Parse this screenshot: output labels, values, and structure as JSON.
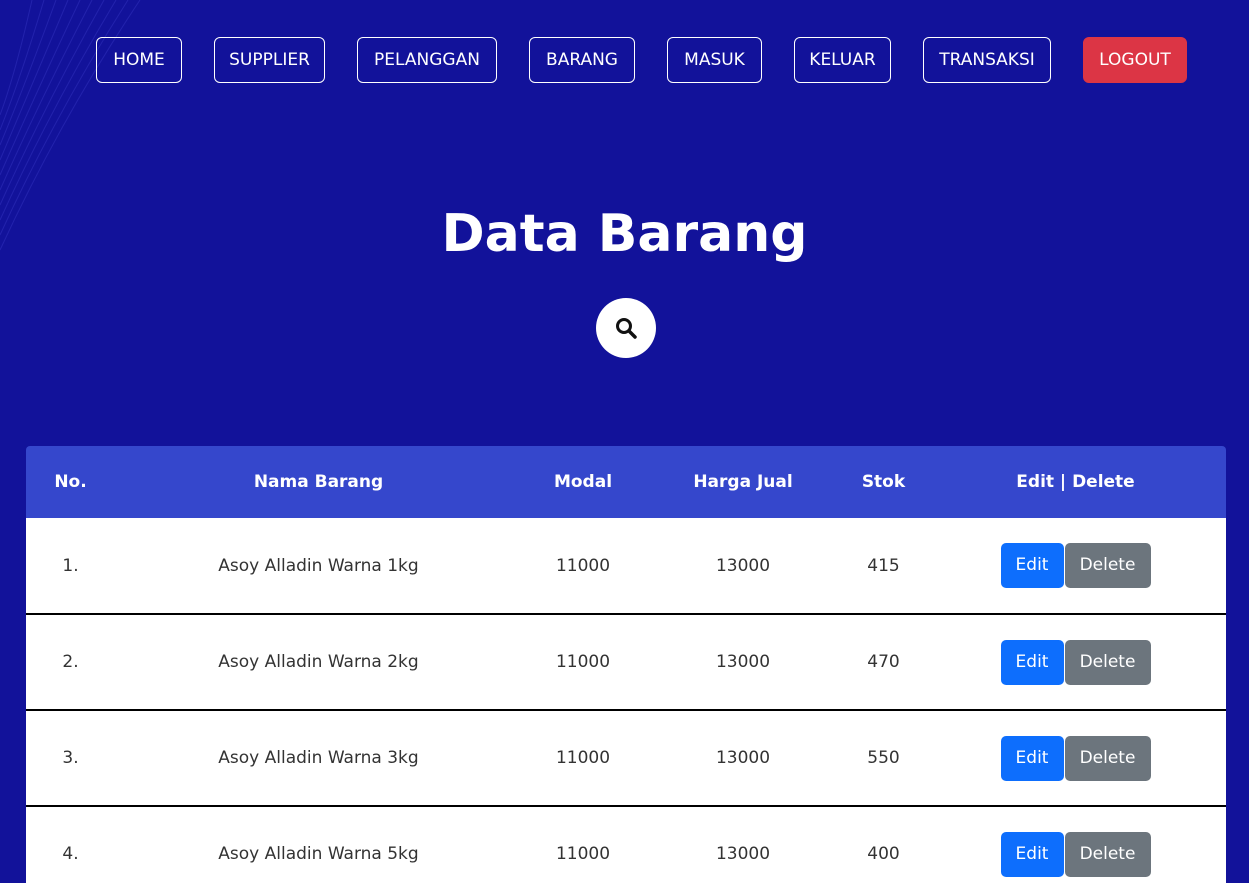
{
  "nav": {
    "items": [
      {
        "label": "HOME"
      },
      {
        "label": "SUPPLIER"
      },
      {
        "label": "PELANGGAN"
      },
      {
        "label": "BARANG"
      },
      {
        "label": "MASUK"
      },
      {
        "label": "KELUAR"
      },
      {
        "label": "TRANSAKSI"
      }
    ],
    "logout_label": "LOGOUT"
  },
  "page": {
    "title": "Data Barang",
    "search_icon": "search-icon"
  },
  "table": {
    "headers": {
      "no": "No.",
      "name": "Nama Barang",
      "modal": "Modal",
      "harga": "Harga Jual",
      "stok": "Stok",
      "actions": "Edit | Delete"
    },
    "edit_label": "Edit",
    "delete_label": "Delete",
    "rows": [
      {
        "no": "1.",
        "name": "Asoy Alladin Warna 1kg",
        "modal": "11000",
        "harga": "13000",
        "stok": "415"
      },
      {
        "no": "2.",
        "name": "Asoy Alladin Warna 2kg",
        "modal": "11000",
        "harga": "13000",
        "stok": "470"
      },
      {
        "no": "3.",
        "name": "Asoy Alladin Warna 3kg",
        "modal": "11000",
        "harga": "13000",
        "stok": "550"
      },
      {
        "no": "4.",
        "name": "Asoy Alladin Warna 5kg",
        "modal": "11000",
        "harga": "13000",
        "stok": "400"
      }
    ]
  },
  "colors": {
    "background": "#12129a",
    "table_header": "#3547cc",
    "logout": "#dc3545",
    "edit": "#0d6efd",
    "delete": "#6c757d"
  }
}
